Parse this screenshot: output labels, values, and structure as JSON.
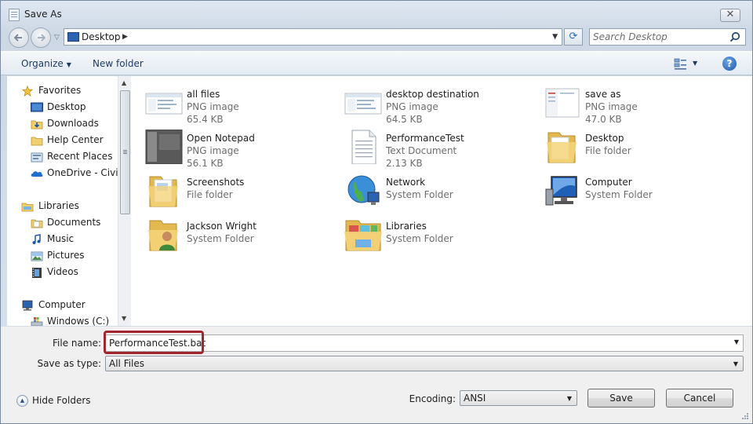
{
  "window": {
    "title": "Save As",
    "close_glyph": "✕"
  },
  "nav": {
    "back_icon": "back-arrow-icon",
    "forward_icon": "forward-arrow-icon",
    "address": "Desktop",
    "refresh_glyph": "⟳",
    "search_placeholder": "Search Desktop"
  },
  "toolbar": {
    "organize_label": "Organize",
    "new_folder_label": "New folder",
    "help_glyph": "?"
  },
  "sidebar": {
    "items": [
      {
        "label": "Favorites",
        "icon": "star-icon"
      },
      {
        "label": "Desktop",
        "icon": "desktop-icon"
      },
      {
        "label": "Downloads",
        "icon": "downloads-folder-icon"
      },
      {
        "label": "Help Center",
        "icon": "folder-icon"
      },
      {
        "label": "Recent Places",
        "icon": "recent-places-icon"
      },
      {
        "label": "OneDrive - CivicPlus",
        "icon": "onedrive-icon"
      },
      {
        "label": "Libraries",
        "icon": "libraries-icon"
      },
      {
        "label": "Documents",
        "icon": "documents-icon"
      },
      {
        "label": "Music",
        "icon": "music-icon"
      },
      {
        "label": "Pictures",
        "icon": "pictures-icon"
      },
      {
        "label": "Videos",
        "icon": "videos-icon"
      },
      {
        "label": "Computer",
        "icon": "computer-icon"
      },
      {
        "label": "Windows (C:)",
        "icon": "drive-icon"
      }
    ]
  },
  "files": [
    {
      "name": "all files",
      "kind": "PNG image",
      "size": "65.4 KB",
      "icon": "png-thumbnail-icon"
    },
    {
      "name": "desktop destination",
      "kind": "PNG image",
      "size": "64.5 KB",
      "icon": "png-thumbnail-icon"
    },
    {
      "name": "save as",
      "kind": "PNG image",
      "size": "47.0 KB",
      "icon": "png-thumbnail-icon"
    },
    {
      "name": "Open Notepad",
      "kind": "PNG image",
      "size": "56.1 KB",
      "icon": "png-thumbnail-icon"
    },
    {
      "name": "PerformanceTest",
      "kind": "Text Document",
      "size": "2.13 KB",
      "icon": "text-document-icon"
    },
    {
      "name": "Desktop",
      "kind": "File folder",
      "size": "",
      "icon": "folder-icon"
    },
    {
      "name": "Screenshots",
      "kind": "File folder",
      "size": "",
      "icon": "folder-icon"
    },
    {
      "name": "Network",
      "kind": "System Folder",
      "size": "",
      "icon": "network-icon"
    },
    {
      "name": "Computer",
      "kind": "System Folder",
      "size": "",
      "icon": "computer-icon"
    },
    {
      "name": "Jackson Wright",
      "kind": "System Folder",
      "size": "",
      "icon": "user-folder-icon"
    },
    {
      "name": "Libraries",
      "kind": "System Folder",
      "size": "",
      "icon": "libraries-icon"
    }
  ],
  "form": {
    "file_name_label": "File name:",
    "file_name_value": "PerformanceTest.bat",
    "save_as_type_label": "Save as type:",
    "save_as_type_value": "All Files",
    "encoding_label": "Encoding:",
    "encoding_value": "ANSI"
  },
  "buttons": {
    "hide_folders": "Hide Folders",
    "save": "Save",
    "cancel": "Cancel"
  },
  "colors": {
    "highlight_border": "#a3262f",
    "accent": "#1d56a8"
  }
}
